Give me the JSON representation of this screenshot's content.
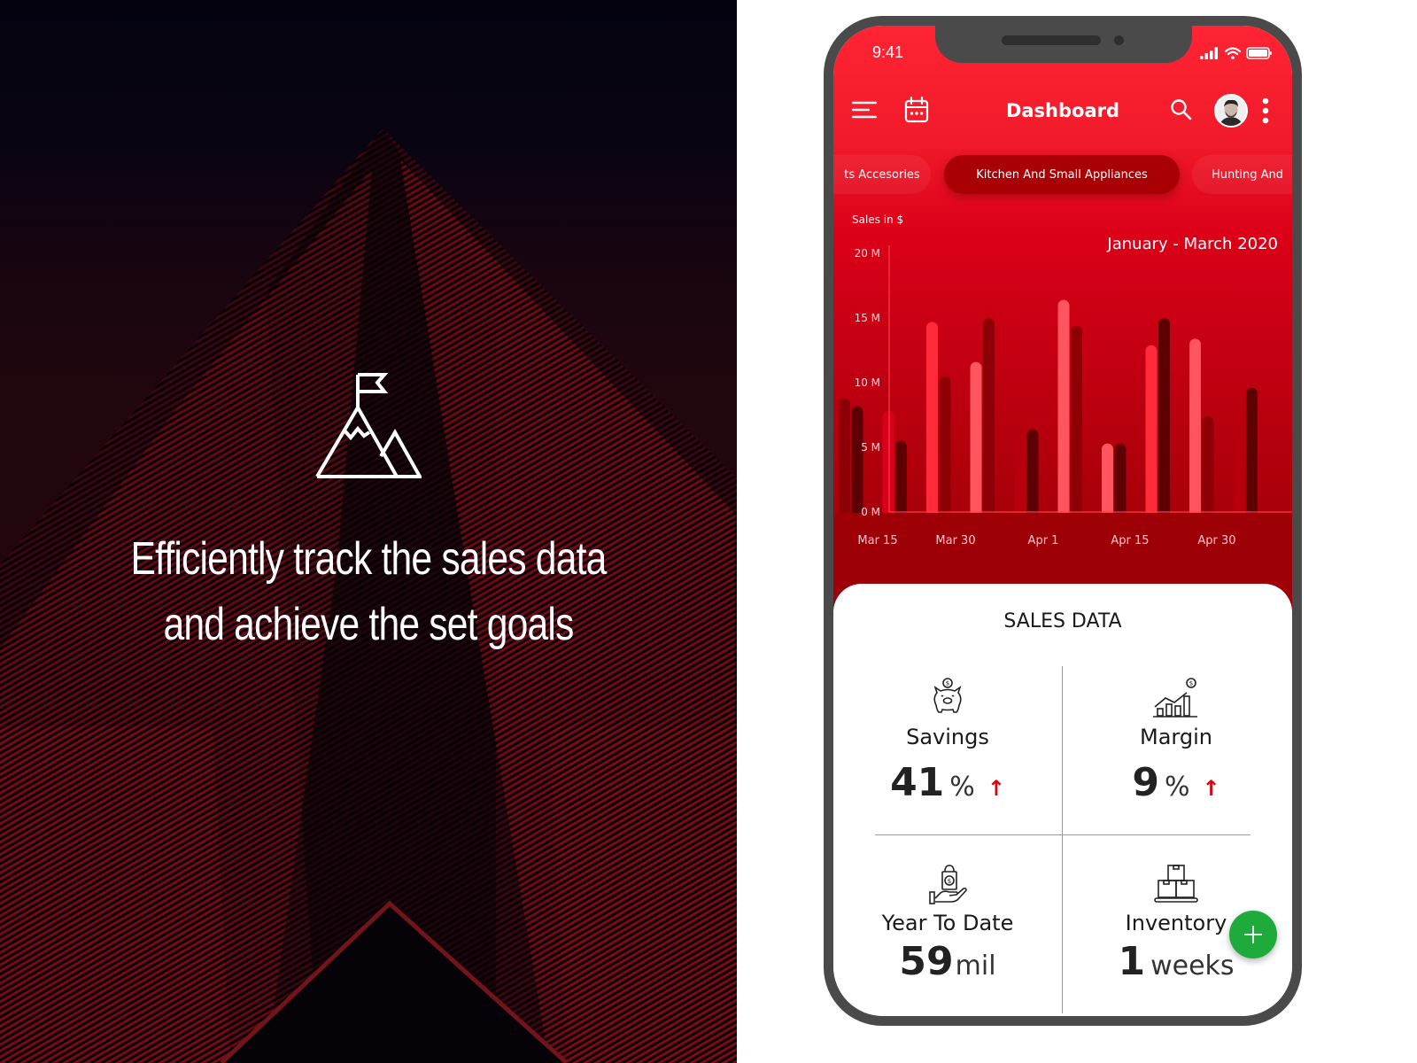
{
  "promo": {
    "icon": "mountain-flag-icon",
    "tagline_line1": "Efficiently track the sales data",
    "tagline_line2": "and achieve the set goals"
  },
  "status_bar": {
    "time": "9:41",
    "icons": [
      "signal-icon",
      "wifi-icon",
      "battery-icon"
    ]
  },
  "app_bar": {
    "title": "Dashboard",
    "left_icons": [
      "menu-icon",
      "calendar-icon"
    ],
    "right_icons": [
      "search-icon",
      "avatar",
      "more-vert-icon"
    ]
  },
  "category_tabs": [
    {
      "label": "ts Accesories",
      "active": false
    },
    {
      "label": "Kitchen And Small Appliances",
      "active": true
    },
    {
      "label": "Hunting And",
      "active": false
    }
  ],
  "chart_data": {
    "type": "bar",
    "title": "January - March 2020",
    "ylabel": "Sales in $",
    "xlabel": "",
    "ylim": [
      0,
      20
    ],
    "yunit": "M",
    "yticks": [
      "0 M",
      "5 M",
      "10 M",
      "15 M",
      "20 M"
    ],
    "categories": [
      "Mar 15",
      "Mar 30",
      "Apr 1",
      "Apr 15",
      "Apr 30"
    ],
    "bars": [
      {
        "value": 8.8,
        "shade": "dark"
      },
      {
        "value": 8.2,
        "shade": "darkest"
      },
      {
        "value": 7.8,
        "shade": "red"
      },
      {
        "value": 5.5,
        "shade": "darkest"
      },
      {
        "value": 14.7,
        "shade": "bright"
      },
      {
        "value": 10.5,
        "shade": "dark"
      },
      {
        "value": 11.6,
        "shade": "light"
      },
      {
        "value": 15.0,
        "shade": "dark"
      },
      {
        "value": 5.8,
        "shade": "mid"
      },
      {
        "value": 6.4,
        "shade": "darkest"
      },
      {
        "value": 16.4,
        "shade": "light"
      },
      {
        "value": 14.4,
        "shade": "dark"
      },
      {
        "value": 5.3,
        "shade": "light"
      },
      {
        "value": 5.3,
        "shade": "darkest"
      },
      {
        "value": 12.9,
        "shade": "bright"
      },
      {
        "value": 15.0,
        "shade": "darkest"
      },
      {
        "value": 13.4,
        "shade": "light"
      },
      {
        "value": 7.4,
        "shade": "dark"
      },
      {
        "value": 6.2,
        "shade": "mid"
      },
      {
        "value": 9.6,
        "shade": "darkest"
      }
    ],
    "colors": {
      "bright": "#ff2a3a",
      "light": "#ff5560",
      "red": "#d9001b",
      "mid": "#b8000d",
      "dark": "#8c0006",
      "darkest": "#5e0003"
    },
    "grid": false
  },
  "sales_card": {
    "title": "SALES DATA",
    "stats": [
      {
        "label": "Savings",
        "value": "41",
        "unit": "%",
        "trend": "up",
        "icon": "piggy-bank-icon"
      },
      {
        "label": "Margin",
        "value": "9",
        "unit": "%",
        "trend": "up",
        "icon": "growth-chart-icon"
      },
      {
        "label": "Year To Date",
        "value": "59",
        "unit": "mil",
        "trend": null,
        "icon": "money-bag-hand-icon"
      },
      {
        "label": "Inventory",
        "value": "1",
        "unit": "weeks",
        "trend": null,
        "icon": "boxes-icon"
      }
    ],
    "trend_arrow": "↑"
  },
  "fab": {
    "icon": "plus-icon"
  },
  "colors": {
    "brand_red": "#f01a2a",
    "active_tab": "#a80005",
    "trend_up": "#e1000f",
    "fab_green": "#1faa3c"
  }
}
